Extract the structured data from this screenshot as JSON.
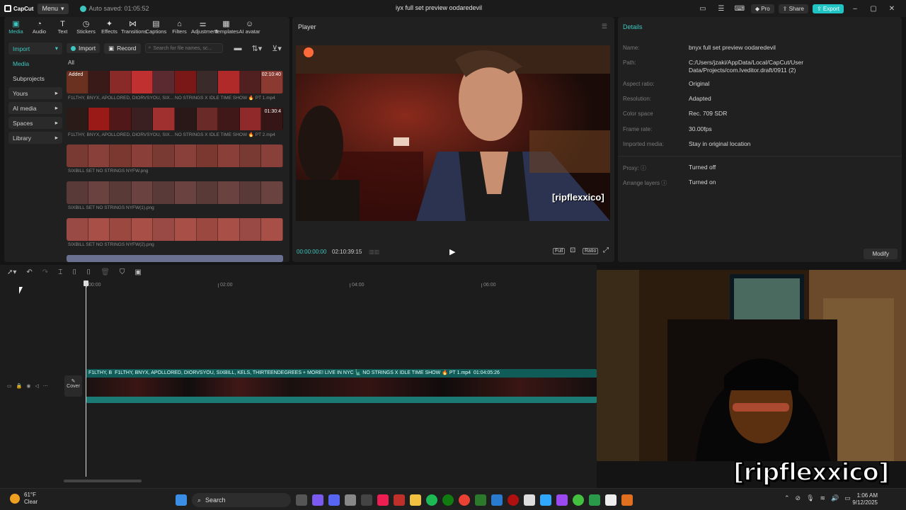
{
  "titlebar": {
    "logo": "CapCut",
    "menu_label": "Menu",
    "autosave": "Auto saved: 01:05:52",
    "project_title": "iyx full set preview oodaredevil",
    "pro_label": "Pro",
    "share_label": "Share",
    "export_label": "Export"
  },
  "tabs": [
    {
      "label": "Media",
      "icon": "▣"
    },
    {
      "label": "Audio",
      "icon": "◔"
    },
    {
      "label": "Text",
      "icon": "T"
    },
    {
      "label": "Stickers",
      "icon": "◷"
    },
    {
      "label": "Effects",
      "icon": "✦"
    },
    {
      "label": "Transitions",
      "icon": "⋈"
    },
    {
      "label": "Captions",
      "icon": "▤"
    },
    {
      "label": "Filters",
      "icon": "⌂"
    },
    {
      "label": "Adjustment",
      "icon": "⚌"
    },
    {
      "label": "Templates",
      "icon": "▦"
    },
    {
      "label": "AI avatar",
      "icon": "☺"
    }
  ],
  "sidebar": {
    "items": [
      {
        "label": "Import",
        "chev": "▾"
      },
      {
        "label": "Media",
        "chev": ""
      },
      {
        "label": "Subprojects",
        "chev": ""
      },
      {
        "label": "Yours",
        "chev": "▸"
      },
      {
        "label": "AI media",
        "chev": "▸"
      },
      {
        "label": "Spaces",
        "chev": "▸"
      },
      {
        "label": "Library",
        "chev": "▸"
      }
    ]
  },
  "media": {
    "import_label": "Import",
    "record_label": "Record",
    "search_placeholder": "Search for file names, sc...",
    "filter_all": "All",
    "clips": [
      {
        "name": "F1LTHY, BNYX, APOLLORED, DIORVSYOU, SIX... NO STRINGS X IDLE TIME SHOW 🔥 PT 1.mp4",
        "duration": "02:10:40",
        "tag": "Added"
      },
      {
        "name": "F1LTHY, BNYX, APOLLORED, DIORVSYOU, SIX... NO STRINGS X IDLE TIME SHOW 🔥 PT 2.mp4",
        "duration": "01:30:4",
        "tag": ""
      },
      {
        "name": "SIXBILL SET NO STRINGS NYFW.png",
        "duration": "",
        "tag": ""
      },
      {
        "name": "SIXBILL SET NO STRINGS NYFW(1).png",
        "duration": "",
        "tag": ""
      },
      {
        "name": "SIXBILL SET NO STRINGS NYFW(2).png",
        "duration": "",
        "tag": ""
      }
    ]
  },
  "player": {
    "title": "Player",
    "current_time": "00:00:00:00",
    "total_time": "02:10:39:15",
    "full_label": "Full",
    "ratio_label": "Ratio",
    "overlay_text": "[ripflexxico]"
  },
  "details": {
    "title": "Details",
    "rows": [
      {
        "label": "Name:",
        "value": "bnyx full set preview oodaredevil"
      },
      {
        "label": "Path:",
        "value": "C:/Users/jzaki/AppData/Local/CapCut/User Data/Projects/com.lveditor.draft/0911 (2)"
      },
      {
        "label": "Aspect ratio:",
        "value": "Original"
      },
      {
        "label": "Resolution:",
        "value": "Adapted"
      },
      {
        "label": "Color space",
        "value": "Rec. 709 SDR"
      },
      {
        "label": "Frame rate:",
        "value": "30.00fps"
      },
      {
        "label": "Imported media:",
        "value": "Stay in original location"
      },
      {
        "label": "Proxy: ⓘ",
        "value": "Turned off"
      },
      {
        "label": "Arrange layers ⓘ",
        "value": "Turned on"
      }
    ],
    "modify_label": "Modify"
  },
  "timeline": {
    "ticks": [
      "00:00",
      "02:00",
      "04:00",
      "06:00"
    ],
    "cover_label": "Cover",
    "clip_title_short": "F1LTHY, B",
    "clip_title": "F1LTHY, BNYX, APOLLORED, DIORVSYOU, SIXBILL, KELS, THIRTEENDEGREES + MORE! LIVE IN NYC 🗽 NO STRINGS X IDLE TIME SHOW 🔥 PT 1.mp4",
    "clip_duration": "01:04:05:26"
  },
  "overlay": {
    "watermark": "[ripflexxico]"
  },
  "taskbar": {
    "temperature": "61°F",
    "weather": "Clear",
    "search_label": "Search",
    "time": "1:06 AM",
    "date": "9/12/2025"
  }
}
